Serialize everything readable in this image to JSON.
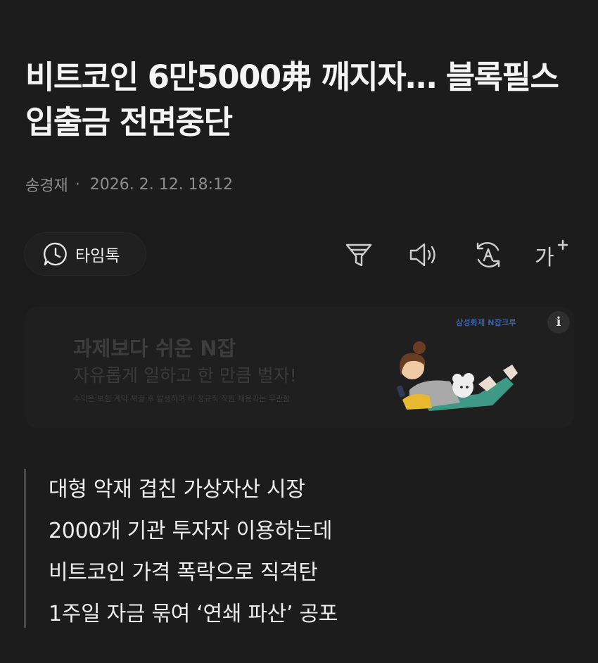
{
  "article": {
    "headline": "비트코인 6만5000弗 깨지자… 블록필스 입출금 전면중단",
    "author": "송경재",
    "separator": "·",
    "timestamp": "2026. 2. 12. 18:12"
  },
  "toolbar": {
    "timetalk_label": "타임톡",
    "font_size_label": "가",
    "icons": [
      "clock-chat-icon",
      "filter-icon",
      "speaker-icon",
      "translate-icon",
      "font-size-icon"
    ]
  },
  "ad": {
    "title": "과제보다 쉬운 N잡",
    "subtitle": "자유롭게 일하고 한 만큼 벌자!",
    "note": "수익은 보험 계약 체결 후 발생하며 비·정규직 직원 채용과는 무관함",
    "brand": "삼성화재 N잡크루",
    "info_glyph": "i"
  },
  "summary": {
    "lines": [
      "대형 악재 겹친 가상자산 시장",
      "2000개 기관 투자자 이용하는데",
      "비트코인 가격 폭락으로 직격탄",
      "1주일 자금 묶여 ‘연쇄 파산’ 공포"
    ]
  },
  "colors": {
    "background": "#1c1c1c",
    "headline": "#f4f4f4",
    "byline": "#8d8d8d",
    "summary_bar": "#4a4a4a",
    "ad_brand": "#3c5fa8"
  }
}
